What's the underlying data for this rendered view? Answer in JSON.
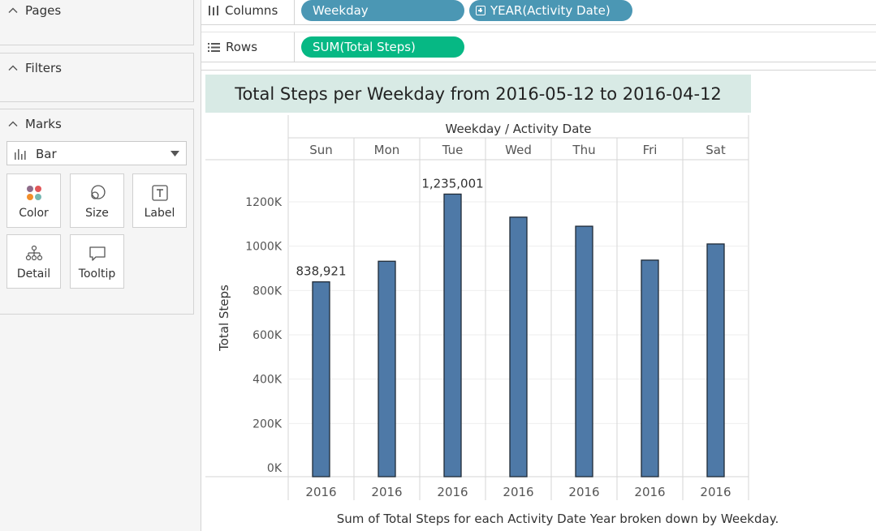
{
  "sidebar": {
    "pages_title": "Pages",
    "filters_title": "Filters",
    "marks_title": "Marks",
    "mark_type": "Bar",
    "mark_buttons": [
      "Color",
      "Size",
      "Label",
      "Detail",
      "Tooltip"
    ]
  },
  "shelves": {
    "columns_label": "Columns",
    "rows_label": "Rows",
    "columns_pills": [
      "Weekday",
      "YEAR(Activity Date)"
    ],
    "rows_pills": [
      "SUM(Total Steps)"
    ]
  },
  "colors": {
    "bar": "#4e79a7",
    "pill_dimension": "#4b97b4",
    "pill_measure": "#06b884",
    "title_band": "#d8eae5"
  },
  "view": {
    "title": "Total Steps per Weekday from 2016-05-12  to  2016-04-12",
    "caption": "Sum of Total Steps for each Activity Date Year broken down by Weekday."
  },
  "chart_data": {
    "type": "bar",
    "header": "Weekday / Activity Date",
    "categories": [
      "Sun",
      "Mon",
      "Tue",
      "Wed",
      "Thu",
      "Fri",
      "Sat"
    ],
    "subcategories": [
      "2016",
      "2016",
      "2016",
      "2016",
      "2016",
      "2016",
      "2016"
    ],
    "series": [
      {
        "values": [
          838921,
          932000,
          1235001,
          1131000,
          1090000,
          937000,
          1010000
        ]
      }
    ],
    "data_labels": [
      "838,921",
      "",
      "1,235,001",
      "",
      "",
      "",
      ""
    ],
    "ylabel": "Total Steps",
    "yticks": [
      0,
      200000,
      400000,
      600000,
      800000,
      1000000,
      1200000
    ],
    "ytick_labels": [
      "0K",
      "200K",
      "400K",
      "600K",
      "800K",
      "1000K",
      "1200K"
    ],
    "ylim": [
      0,
      1380000
    ],
    "grid": true
  }
}
